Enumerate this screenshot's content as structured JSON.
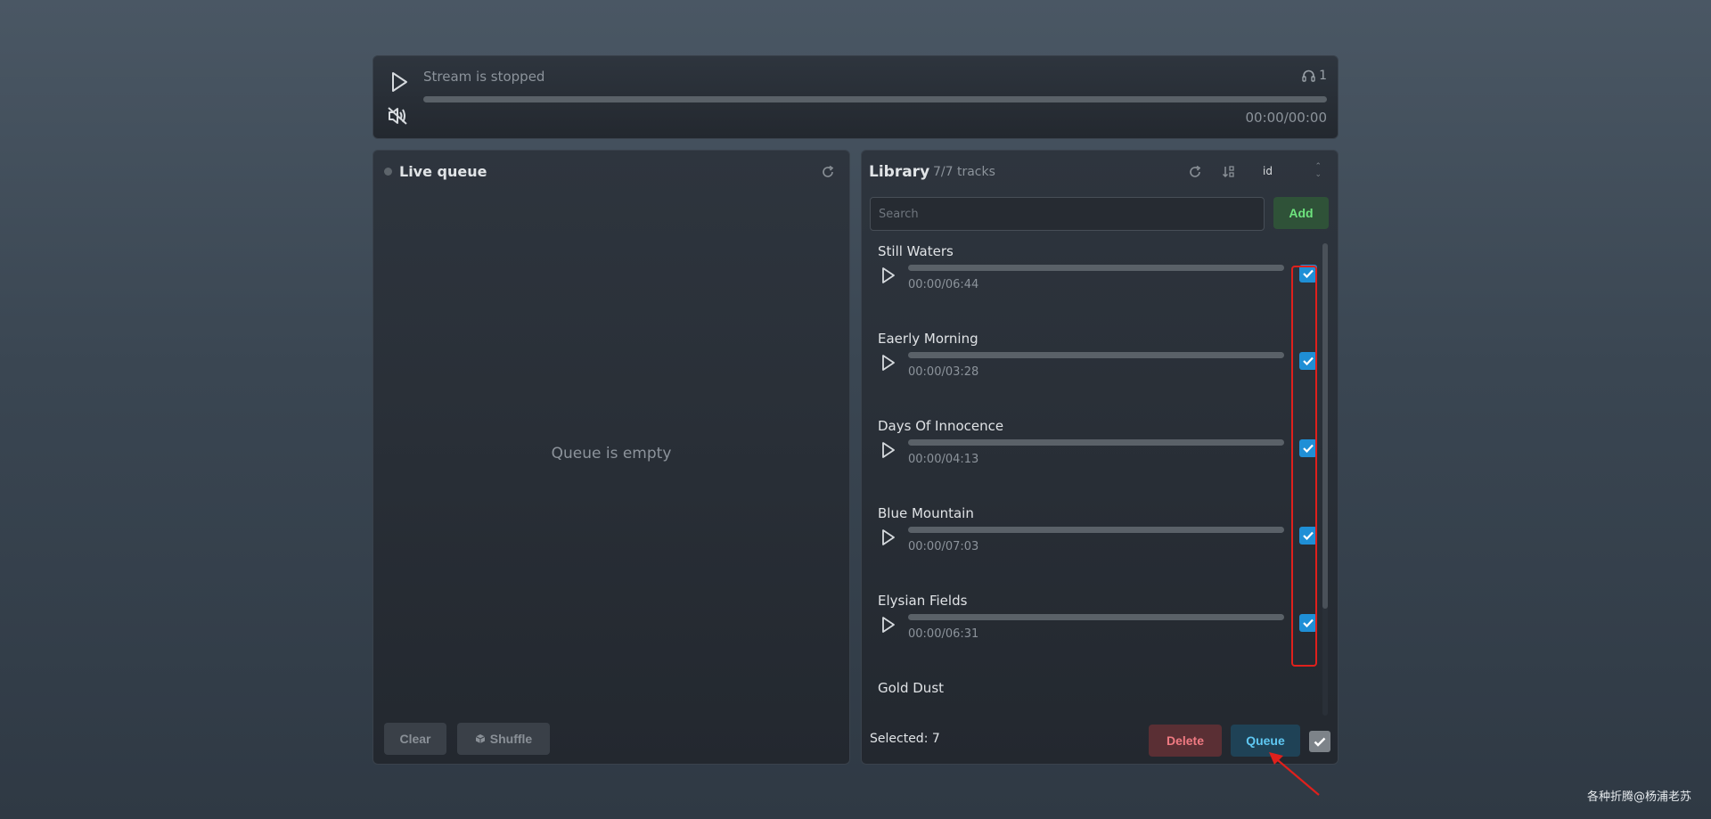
{
  "player": {
    "status": "Stream is stopped",
    "listeners": "1",
    "time": "00:00/00:00",
    "icons": {
      "play": "play-icon",
      "mute": "volume-muted-icon",
      "listeners": "headphones-icon"
    }
  },
  "queue": {
    "title": "Live queue",
    "empty_message": "Queue is empty",
    "clear_label": "Clear",
    "shuffle_label": "Shuffle"
  },
  "library": {
    "title": "Library",
    "count": "7/7 tracks",
    "sort_value": "id",
    "search_placeholder": "Search",
    "add_label": "Add",
    "tracks": [
      {
        "title": "Still Waters",
        "time": "00:00/06:44",
        "checked": true
      },
      {
        "title": "Eaerly Morning",
        "time": "00:00/03:28",
        "checked": true
      },
      {
        "title": "Days Of Innocence",
        "time": "00:00/04:13",
        "checked": true
      },
      {
        "title": "Blue Mountain",
        "time": "00:00/07:03",
        "checked": true
      },
      {
        "title": "Elysian Fields",
        "time": "00:00/06:31",
        "checked": true
      },
      {
        "title": "Gold Dust",
        "time": "",
        "checked": true
      }
    ],
    "selected_label": "Selected: 7",
    "delete_label": "Delete",
    "queue_label": "Queue"
  },
  "colors": {
    "accent_check": "#1f8fd6",
    "add_text": "#6ee47e",
    "delete_text": "#f07a82",
    "queue_text": "#5fc8f3",
    "annotation_red": "#e0201c"
  },
  "watermark": "各种折腾@杨浦老苏"
}
